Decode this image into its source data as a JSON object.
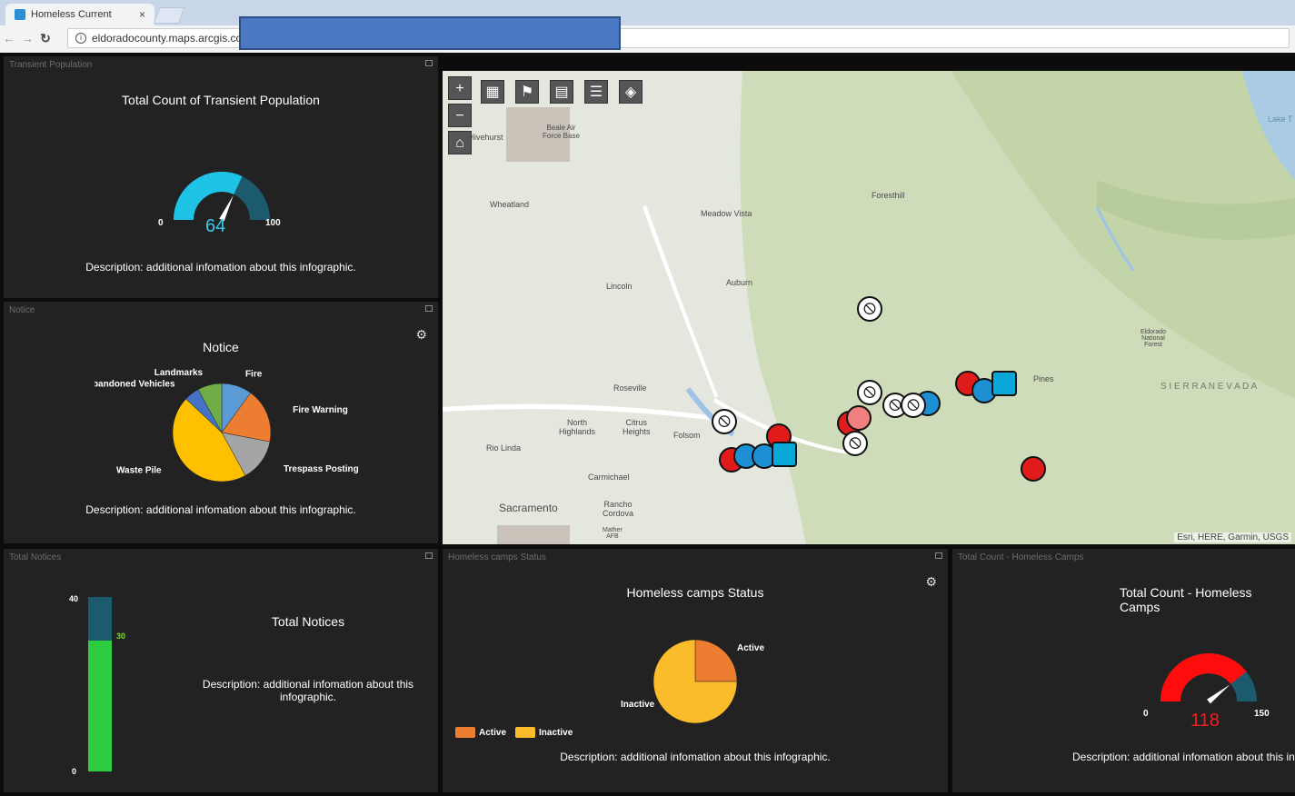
{
  "browser": {
    "tab_title": "Homeless Current",
    "tab_close": "×",
    "url": "eldoradocounty.maps.arcgis.com"
  },
  "panels": {
    "transient": {
      "header": "Transient Population",
      "title": "Total Count of Transient Population",
      "gauge": {
        "min": "0",
        "max": "100",
        "value": "64",
        "fraction": 0.64,
        "color": "#1fc3e6",
        "track": "#1c5a6e"
      },
      "description": "Description: additional infomation about this infographic."
    },
    "notice": {
      "header": "Notice",
      "title": "Notice",
      "description": "Description: additional infomation about this infographic."
    },
    "total_notices": {
      "header": "Total Notices",
      "title": "Total Notices",
      "description": "Description: additional infomation about this infographic.",
      "axis_max": "40",
      "axis_min": "0",
      "value_label": "30"
    },
    "camps_status": {
      "header": "Homeless camps Status",
      "title": "Homeless camps Status",
      "legend_active": "Active",
      "legend_inactive": "Inactive",
      "label_active": "Active",
      "label_inactive": "Inactive",
      "description": "Description: additional infomation about this infographic."
    },
    "camps_total": {
      "header": "Total Count - Homeless Camps",
      "title": "Total Count - Homeless Camps",
      "gauge": {
        "min": "0",
        "max": "150",
        "value": "118",
        "fraction": 0.787,
        "color": "#ff0d0d",
        "track": "#1c5a6e"
      },
      "description": "Description: additional infomation about this infographic."
    }
  },
  "map": {
    "labels": {
      "beale": "Beale Air\nForce Base",
      "olivehurst": "Olivehurst",
      "wheatland": "Wheatland",
      "meadow": "Meadow Vista",
      "foresthill": "Foresthill",
      "lincoln": "Lincoln",
      "auburn": "Auburn",
      "roseville": "Roseville",
      "north_highlands": "North\nHighlands",
      "citrus": "Citrus\nHeights",
      "folsom": "Folsom",
      "rio_linda": "Rio Linda",
      "carmichael": "Carmichael",
      "sacramento": "Sacramento",
      "rancho": "Rancho\nCordova",
      "mather": "Mather\nAFB",
      "sierra": "S I E R R A   N E V A D A",
      "pines": "Pines",
      "eldorado_forest": "Eldorado\nNational\nForest",
      "lake": "Lake T"
    },
    "attribution": "Esri, HERE, Garmin, USGS"
  },
  "chart_data": [
    {
      "type": "pie",
      "title": "Notice",
      "categories": [
        "Fire",
        "Fire Warning",
        "Trespass Posting",
        "Waste Pile",
        "Abandoned Vehicles",
        "Landmarks"
      ],
      "values": [
        10,
        18,
        14,
        45,
        5,
        8
      ],
      "colors": [
        "#5b9bd5",
        "#ed7d31",
        "#a5a5a5",
        "#ffc000",
        "#4472c4",
        "#70ad47"
      ]
    },
    {
      "type": "bar",
      "title": "Total Notices",
      "categories": [
        ""
      ],
      "values": [
        30
      ],
      "ylim": [
        0,
        40
      ],
      "colors": [
        "#2ecc40",
        "#1c5a6e"
      ]
    },
    {
      "type": "pie",
      "title": "Homeless camps Status",
      "categories": [
        "Active",
        "Inactive"
      ],
      "values": [
        25,
        75
      ],
      "colors": [
        "#ed7d31",
        "#fbbc2b"
      ],
      "legend": "bottom-left"
    }
  ]
}
